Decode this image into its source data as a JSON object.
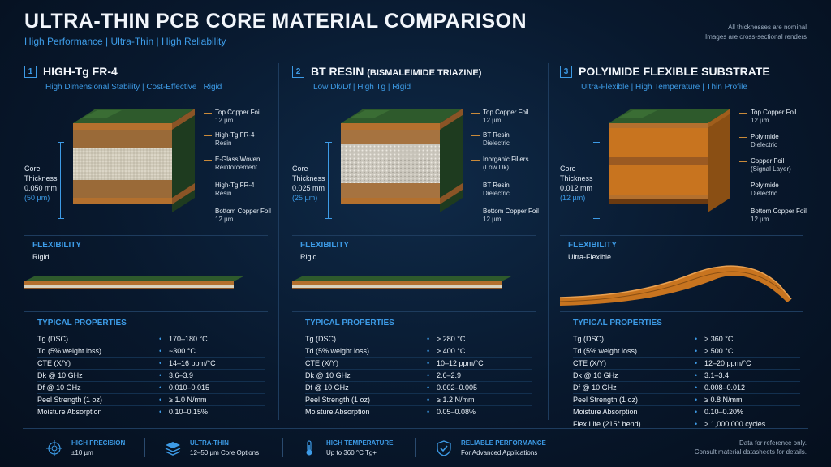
{
  "header": {
    "title": "ULTRA-THIN PCB CORE MATERIAL COMPARISON",
    "subtitle": "High Performance | Ultra-Thin | High Reliability",
    "note_line1": "All thicknesses are nominal",
    "note_line2": "Images are cross-sectional renders"
  },
  "columns": [
    {
      "number": "1",
      "name": "HIGH-Tg FR-4",
      "name_paren": "",
      "tagline": "High Dimensional Stability | Cost-Effective | Rigid",
      "core_label": "Core\nThickness",
      "core_mm": "0.050 mm",
      "core_um": "(50 µm)",
      "layers": [
        {
          "name": "Top Copper Foil",
          "detail": "12 µm"
        },
        {
          "name": "High-Tg FR-4",
          "detail": "Resin"
        },
        {
          "name": "E-Glass Woven",
          "detail": "Reinforcement"
        },
        {
          "name": "High-Tg FR-4",
          "detail": "Resin"
        },
        {
          "name": "Bottom Copper Foil",
          "detail": "12 µm"
        }
      ],
      "flexibility_label": "FLEXIBILITY",
      "flexibility_value": "Rigid",
      "properties_label": "TYPICAL PROPERTIES",
      "properties": [
        {
          "k": "Tg (DSC)",
          "v": "170–180 °C"
        },
        {
          "k": "Td (5% weight loss)",
          "v": "~300 °C"
        },
        {
          "k": "CTE (X/Y)",
          "v": "14–16 ppm/°C"
        },
        {
          "k": "Dk @ 10 GHz",
          "v": "3.6–3.9"
        },
        {
          "k": "Df @ 10 GHz",
          "v": "0.010–0.015"
        },
        {
          "k": "Peel Strength (1 oz)",
          "v": "≥ 1.0 N/mm"
        },
        {
          "k": "Moisture Absorption",
          "v": "0.10–0.15%"
        }
      ]
    },
    {
      "number": "2",
      "name": "BT RESIN",
      "name_paren": "(BISMALEIMIDE TRIAZINE)",
      "tagline": "Low Dk/Df | High Tg | Rigid",
      "core_label": "Core\nThickness",
      "core_mm": "0.025 mm",
      "core_um": "(25 µm)",
      "layers": [
        {
          "name": "Top Copper Foil",
          "detail": "12 µm"
        },
        {
          "name": "BT Resin",
          "detail": "Dielectric"
        },
        {
          "name": "Inorganic Fillers",
          "detail": "(Low Dk)"
        },
        {
          "name": "BT Resin",
          "detail": "Dielectric"
        },
        {
          "name": "Bottom Copper Foil",
          "detail": "12 µm"
        }
      ],
      "flexibility_label": "FLEXIBILITY",
      "flexibility_value": "Rigid",
      "properties_label": "TYPICAL PROPERTIES",
      "properties": [
        {
          "k": "Tg (DSC)",
          "v": "> 280 °C"
        },
        {
          "k": "Td (5% weight loss)",
          "v": "> 400 °C"
        },
        {
          "k": "CTE (X/Y)",
          "v": "10–12 ppm/°C"
        },
        {
          "k": "Dk @ 10 GHz",
          "v": "2.6–2.9"
        },
        {
          "k": "Df @ 10 GHz",
          "v": "0.002–0.005"
        },
        {
          "k": "Peel Strength (1 oz)",
          "v": "≥ 1.2 N/mm"
        },
        {
          "k": "Moisture Absorption",
          "v": "0.05–0.08%"
        }
      ]
    },
    {
      "number": "3",
      "name": "POLYIMIDE FLEXIBLE SUBSTRATE",
      "name_paren": "",
      "tagline": "Ultra-Flexible | High Temperature | Thin Profile",
      "core_label": "Core\nThickness",
      "core_mm": "0.012 mm",
      "core_um": "(12 µm)",
      "layers": [
        {
          "name": "Top Copper Foil",
          "detail": "12 µm"
        },
        {
          "name": "Polyimide",
          "detail": "Dielectric"
        },
        {
          "name": "Copper Foil",
          "detail": "(Signal Layer)"
        },
        {
          "name": "Polyimide",
          "detail": "Dielectric"
        },
        {
          "name": "Bottom Copper Foil",
          "detail": "12 µm"
        }
      ],
      "flexibility_label": "FLEXIBILITY",
      "flexibility_value": "Ultra-Flexible",
      "properties_label": "TYPICAL PROPERTIES",
      "properties": [
        {
          "k": "Tg (DSC)",
          "v": "> 360 °C"
        },
        {
          "k": "Td (5% weight loss)",
          "v": "> 500 °C"
        },
        {
          "k": "CTE (X/Y)",
          "v": "12–20 ppm/°C"
        },
        {
          "k": "Dk @ 10 GHz",
          "v": "3.1–3.4"
        },
        {
          "k": "Df @ 10 GHz",
          "v": "0.008–0.012"
        },
        {
          "k": "Peel Strength (1 oz)",
          "v": "≥ 0.8 N/mm"
        },
        {
          "k": "Moisture Absorption",
          "v": "0.10–0.20%"
        },
        {
          "k": "Flex Life (215° bend)",
          "v": "> 1,000,000 cycles"
        }
      ]
    }
  ],
  "features": [
    {
      "icon": "crosshair-icon",
      "title": "HIGH PRECISION",
      "desc": "±10 µm"
    },
    {
      "icon": "layers-icon",
      "title": "ULTRA-THIN",
      "desc": "12–50 µm Core Options"
    },
    {
      "icon": "thermometer-icon",
      "title": "HIGH TEMPERATURE",
      "desc": "Up to 360 °C Tg+"
    },
    {
      "icon": "shield-check-icon",
      "title": "RELIABLE PERFORMANCE",
      "desc": "For Advanced Applications"
    }
  ],
  "disclaimer": {
    "line1": "Data for reference only.",
    "line2": "Consult material datasheets for details."
  },
  "colors": {
    "accent": "#3d9be6",
    "copper": "#c07a3a",
    "pcb_green": "#2e5a2c",
    "polyimide": "#c8741f",
    "background": "#071426"
  }
}
